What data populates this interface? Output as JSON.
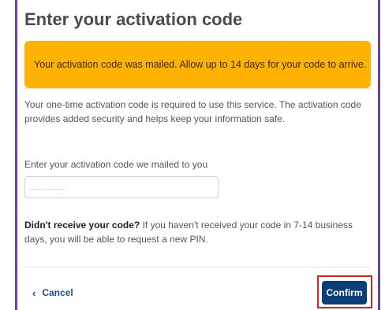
{
  "page": {
    "title": "Enter your activation code"
  },
  "alert": {
    "message": "Your activation code was mailed. Allow up to 14 days for your code to arrive.",
    "color": "#ffb300"
  },
  "intro": {
    "text": "Your one-time activation code is required to use this service. The activation code provides added security and helps keep your information safe."
  },
  "code_field": {
    "label": "Enter your activation code we mailed to you",
    "value": "",
    "placeholder": "______"
  },
  "help": {
    "strong": "Didn't receive your code?",
    "text": " If you haven't received your code in 7-14 business days, you will be able to request a new PIN."
  },
  "actions": {
    "cancel_label": "Cancel",
    "cancel_icon": "chevron-left-icon",
    "confirm_label": "Confirm",
    "confirm_color": "#0b3f7a",
    "highlight_color": "#e01e1e"
  },
  "frame": {
    "border_color": "#6b3fa0"
  }
}
